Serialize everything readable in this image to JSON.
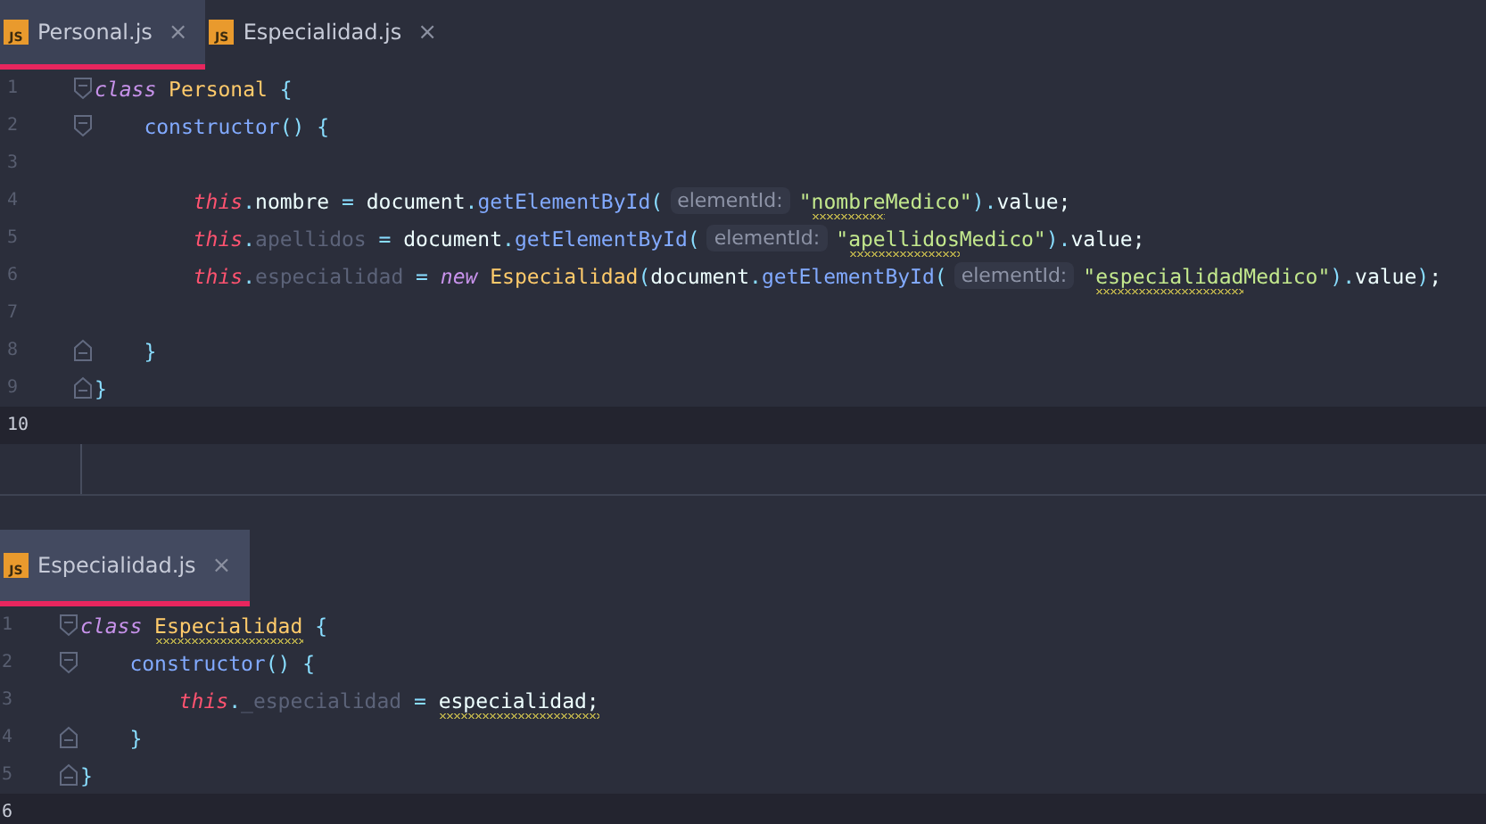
{
  "panes": [
    {
      "tabs": [
        {
          "label": "Personal.js",
          "icon_text": "JS",
          "close": "×",
          "selected": true
        },
        {
          "label": "Especialidad.js",
          "icon_text": "JS",
          "close": "×",
          "selected": false
        }
      ],
      "lines": [
        {
          "number": "1",
          "kind": "opener",
          "current": false,
          "tokens": [
            {
              "kind": "keyword",
              "text": "class"
            },
            {
              "kind": "type",
              "text": " Personal"
            },
            {
              "kind": "punct",
              "text": " {"
            }
          ]
        },
        {
          "number": "2",
          "kind": "opener",
          "current": false,
          "tokens": [
            {
              "kind": "method",
              "text": "    constructor"
            },
            {
              "kind": "punct",
              "text": "() {"
            }
          ]
        },
        {
          "number": "3",
          "kind": "plain",
          "current": false
        },
        {
          "number": "4",
          "kind": "plain",
          "current": false,
          "tokens": [
            {
              "kind": "this",
              "text": "        this"
            },
            {
              "kind": "op",
              "text": "."
            },
            {
              "kind": "plain",
              "text": "nombre"
            },
            {
              "kind": "op",
              "text": " = "
            },
            {
              "kind": "plain",
              "text": "document"
            },
            {
              "kind": "op",
              "text": "."
            },
            {
              "kind": "method",
              "text": "getElementById"
            },
            {
              "kind": "punct",
              "text": "("
            },
            {
              "kind": "hint",
              "text": "elementId:"
            },
            {
              "kind": "string",
              "text": "\""
            },
            {
              "kind": "string",
              "text": "nombre",
              "warn": true
            },
            {
              "kind": "string",
              "text": "Medico\""
            },
            {
              "kind": "punct",
              "text": ")"
            },
            {
              "kind": "op",
              "text": "."
            },
            {
              "kind": "plain",
              "text": "value;"
            }
          ]
        },
        {
          "number": "5",
          "kind": "plain",
          "current": false,
          "tokens": [
            {
              "kind": "this",
              "text": "        this"
            },
            {
              "kind": "op",
              "text": "."
            },
            {
              "kind": "field",
              "text": "apellidos"
            },
            {
              "kind": "op",
              "text": " = "
            },
            {
              "kind": "plain",
              "text": "document"
            },
            {
              "kind": "op",
              "text": "."
            },
            {
              "kind": "method",
              "text": "getElementById"
            },
            {
              "kind": "punct",
              "text": "("
            },
            {
              "kind": "hint",
              "text": "elementId:"
            },
            {
              "kind": "string",
              "text": "\""
            },
            {
              "kind": "string",
              "text": "apellidos",
              "warn": true
            },
            {
              "kind": "string",
              "text": "Medico\""
            },
            {
              "kind": "punct",
              "text": ")"
            },
            {
              "kind": "op",
              "text": "."
            },
            {
              "kind": "plain",
              "text": "value;"
            }
          ]
        },
        {
          "number": "6",
          "kind": "plain",
          "current": false,
          "tokens": [
            {
              "kind": "this",
              "text": "        this"
            },
            {
              "kind": "op",
              "text": "."
            },
            {
              "kind": "field",
              "text": "especialidad"
            },
            {
              "kind": "op",
              "text": " = "
            },
            {
              "kind": "keyword",
              "text": "new"
            },
            {
              "kind": "type",
              "text": " Especialidad"
            },
            {
              "kind": "punct",
              "text": "("
            },
            {
              "kind": "plain",
              "text": "document"
            },
            {
              "kind": "op",
              "text": "."
            },
            {
              "kind": "method",
              "text": "getElementById"
            },
            {
              "kind": "punct",
              "text": "("
            },
            {
              "kind": "hint",
              "text": "elementId:"
            },
            {
              "kind": "string",
              "text": "\""
            },
            {
              "kind": "string",
              "text": "especialidad",
              "warn": true
            },
            {
              "kind": "string",
              "text": "Medico\""
            },
            {
              "kind": "punct",
              "text": ")"
            },
            {
              "kind": "op",
              "text": "."
            },
            {
              "kind": "plain",
              "text": "value"
            },
            {
              "kind": "punct",
              "text": ")"
            },
            {
              "kind": "plain",
              "text": ";"
            }
          ]
        },
        {
          "number": "7",
          "kind": "plain",
          "current": false
        },
        {
          "number": "8",
          "kind": "closer",
          "current": false,
          "tokens": [
            {
              "kind": "punct",
              "text": "    }"
            }
          ]
        },
        {
          "number": "9",
          "kind": "closer",
          "current": false,
          "tokens": [
            {
              "kind": "punct",
              "text": "}"
            }
          ]
        },
        {
          "number": "10",
          "kind": "plain",
          "current": true
        }
      ]
    },
    {
      "tabs": [
        {
          "label": "Especialidad.js",
          "icon_text": "JS",
          "close": "×",
          "selected": true
        }
      ],
      "lines": [
        {
          "number": "1",
          "kind": "opener",
          "current": false,
          "tokens": [
            {
              "kind": "keyword",
              "text": "class "
            },
            {
              "kind": "type",
              "text": "Especialidad",
              "warn": true
            },
            {
              "kind": "punct",
              "text": " {"
            }
          ]
        },
        {
          "number": "2",
          "kind": "opener",
          "current": false,
          "tokens": [
            {
              "kind": "method",
              "text": "    constructor"
            },
            {
              "kind": "punct",
              "text": "() {"
            }
          ]
        },
        {
          "number": "3",
          "kind": "plain",
          "current": false,
          "tokens": [
            {
              "kind": "this",
              "text": "        this"
            },
            {
              "kind": "op",
              "text": "."
            },
            {
              "kind": "field",
              "text": "_especialidad"
            },
            {
              "kind": "op",
              "text": " = "
            },
            {
              "kind": "plain",
              "text": "especialidad;",
              "warn": true
            }
          ]
        },
        {
          "number": "4",
          "kind": "closer",
          "current": false,
          "tokens": [
            {
              "kind": "punct",
              "text": "    }"
            }
          ]
        },
        {
          "number": "5",
          "kind": "closer",
          "current": false,
          "tokens": [
            {
              "kind": "punct",
              "text": "}"
            }
          ]
        },
        {
          "number": "6",
          "kind": "plain",
          "current": true
        }
      ]
    }
  ]
}
